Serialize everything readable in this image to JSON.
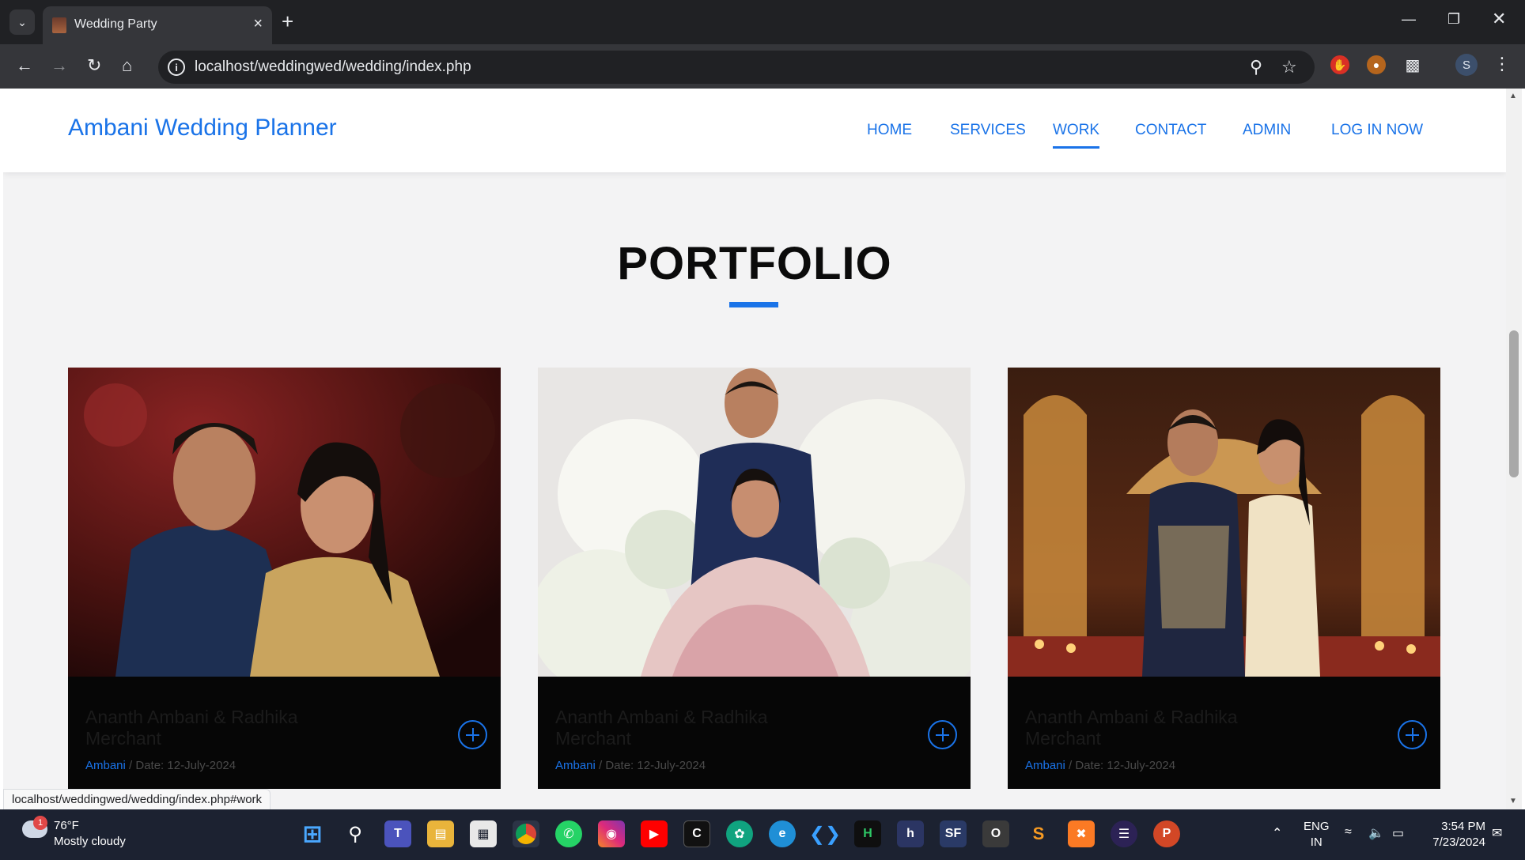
{
  "browser": {
    "tab_title": "Wedding Party",
    "url": "localhost/weddingwed/wedding/index.php",
    "status_url": "localhost/weddingwed/wedding/index.php#work",
    "profile_initial": "S"
  },
  "site": {
    "brand": "Ambani Wedding Planner",
    "nav": [
      {
        "label": "HOME",
        "active": false
      },
      {
        "label": "SERVICES",
        "active": false
      },
      {
        "label": "WORK",
        "active": true
      },
      {
        "label": "CONTACT",
        "active": false
      },
      {
        "label": "ADMIN",
        "active": false
      },
      {
        "label": "LOG IN NOW",
        "active": false
      }
    ]
  },
  "portfolio": {
    "title": "PORTFOLIO",
    "accent_color": "#1a73e8",
    "cards": [
      {
        "name": "Ananth Ambani & Radhika Merchant",
        "category": "Ambani",
        "date": "/ Date: 12-July-2024"
      },
      {
        "name": "Ananth Ambani & Radhika Merchant",
        "category": "Ambani",
        "date": "/ Date: 12-July-2024"
      },
      {
        "name": "Ananth Ambani & Radhika Merchant",
        "category": "Ambani",
        "date": "/ Date: 12-July-2024"
      }
    ]
  },
  "taskbar": {
    "weather_temp": "76°F",
    "weather_desc": "Mostly cloudy",
    "weather_badge": "1",
    "lang_line1": "ENG",
    "lang_line2": "IN",
    "time": "3:54 PM",
    "date": "7/23/2024"
  }
}
